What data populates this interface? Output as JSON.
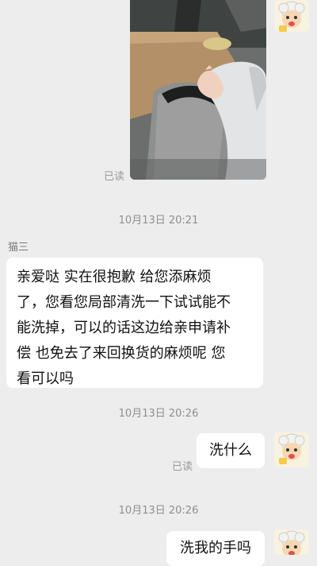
{
  "messages": {
    "photo_read_status": "已读",
    "time_1": "10月13日 20:21",
    "sender_name": "猫三",
    "incoming_lines": [
      "亲爱哒 实在很抱歉 给您添麻烦",
      "了，您看您局部清洗一下试试能不",
      "能洗掉，可以的话这边给亲申请补",
      "偿 也免去了来回换货的麻烦呢 您",
      "看可以吗"
    ],
    "time_2": "10月13日 20:26",
    "reply_1": "洗什么",
    "reply_1_status": "已读",
    "time_3": "10月13日 20:26",
    "reply_2": "洗我的手吗"
  },
  "icons": {
    "avatar": "cartoon-sheep-avatar",
    "photo": "photo-thumbnail"
  },
  "colors": {
    "background": "#ededed",
    "bubble": "#ffffff"
  }
}
